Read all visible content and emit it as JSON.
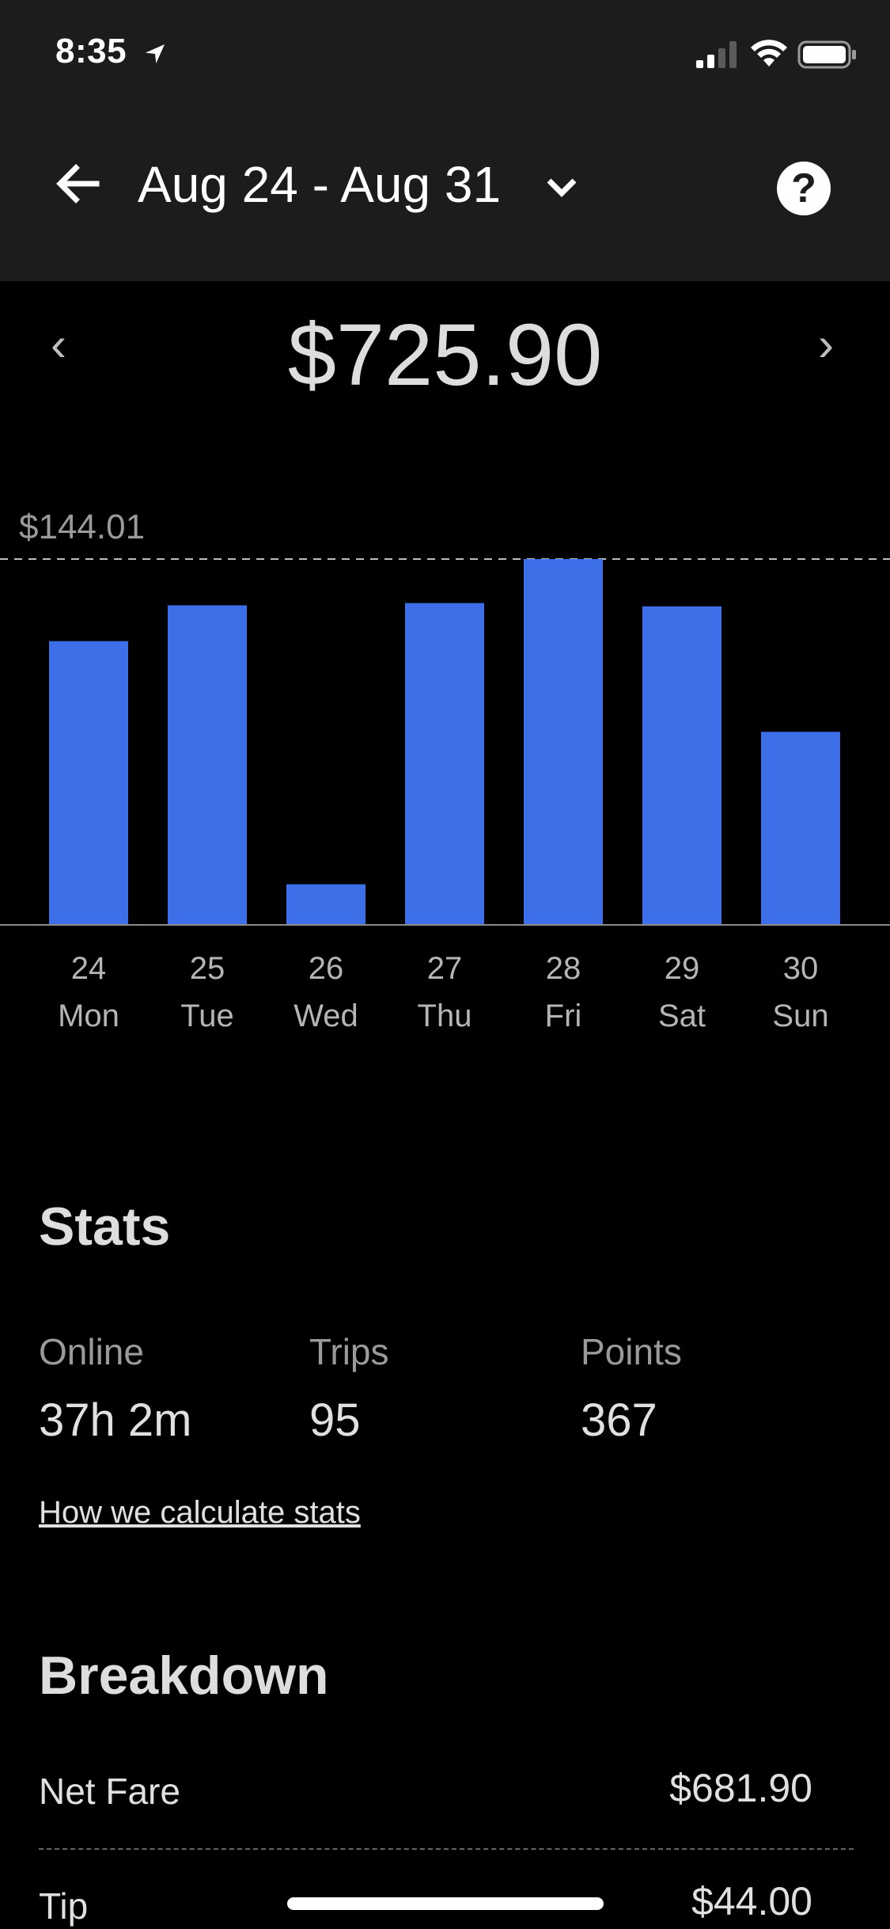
{
  "status_bar": {
    "time": "8:35",
    "location_icon": "location-arrow-icon",
    "signal_icon": "cell-signal-icon",
    "wifi_icon": "wifi-icon",
    "battery_icon": "battery-icon"
  },
  "header": {
    "back_icon": "arrow-left-icon",
    "title": "Aug 24 - Aug 31",
    "dropdown_icon": "chevron-down-icon",
    "help_label": "?"
  },
  "summary": {
    "prev_label": "‹",
    "next_label": "›",
    "total": "$725.90"
  },
  "chart_data": {
    "type": "bar",
    "categories": [
      "24 Mon",
      "25 Tue",
      "26 Wed",
      "27 Thu",
      "28 Fri",
      "29 Sat",
      "30 Sun"
    ],
    "day_numbers": [
      "24",
      "25",
      "26",
      "27",
      "28",
      "29",
      "30"
    ],
    "day_names": [
      "Mon",
      "Tue",
      "Wed",
      "Thu",
      "Fri",
      "Sat",
      "Sun"
    ],
    "values": [
      111.7,
      125.8,
      16.0,
      126.7,
      144.01,
      125.4,
      76.0
    ],
    "max_label": "$144.01",
    "ylim": [
      0,
      144.01
    ],
    "bar_color": "#3d6fe8",
    "reference_line": "dashed",
    "grid": false
  },
  "stats": {
    "heading": "Stats",
    "items": [
      {
        "label": "Online",
        "value": "37h 2m"
      },
      {
        "label": "Trips",
        "value": "95"
      },
      {
        "label": "Points",
        "value": "367"
      }
    ],
    "link": "How we calculate stats"
  },
  "breakdown": {
    "heading": "Breakdown",
    "rows": [
      {
        "label": "Net Fare",
        "value": "$681.90"
      },
      {
        "label": "Tip",
        "value": "$44.00"
      }
    ]
  },
  "colors": {
    "header_bg": "#1c1c1c",
    "page_bg": "#000000",
    "accent": "#3d6fe8"
  }
}
